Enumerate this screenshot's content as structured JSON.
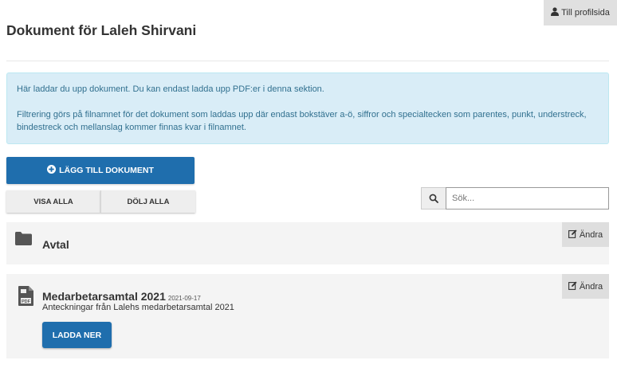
{
  "header": {
    "profile_link_label": "Till profilsida",
    "profile_icon": "user-icon",
    "title": "Dokument för Laleh Shirvani"
  },
  "info": {
    "line1": "Här laddar du upp dokument. Du kan endast ladda upp PDF:er i denna sektion.",
    "line2": "Filtrering görs på filnamnet för det dokument som laddas upp där endast bokstäver a-ö, siffror och specialtecken som parentes, punkt, understreck, bindestreck och mellanslag kommer finnas kvar i filnamnet."
  },
  "actions": {
    "add_label": "LÄGG TILL DOKUMENT",
    "add_icon": "plus-circle-icon",
    "show_all_label": "VISA ALLA",
    "hide_all_label": "DÖLJ ALLA"
  },
  "search": {
    "placeholder": "Sök...",
    "value": "",
    "icon": "search-icon"
  },
  "folders": [
    {
      "name": "Avtal",
      "icon": "folder-icon",
      "edit_label": "Ändra"
    }
  ],
  "documents": [
    {
      "title": "Medarbetarsamtal 2021",
      "date": "2021-09-17",
      "description": "Anteckningar från Lalehs medarbetarsamtal 2021",
      "icon": "pdf-file-icon",
      "download_label": "LADDA NER",
      "edit_label": "Ändra"
    }
  ],
  "colors": {
    "primary": "#1f6ead",
    "info_bg": "#d9edf7",
    "info_text": "#31708f",
    "panel_bg": "#f4f4f4"
  }
}
